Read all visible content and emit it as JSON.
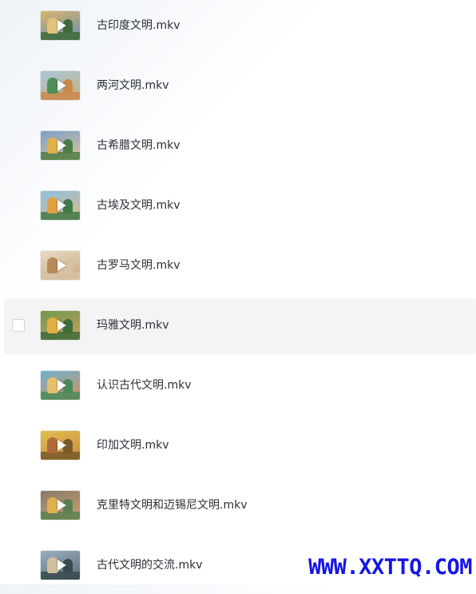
{
  "files": [
    {
      "name": "古印度文明.mkv",
      "thumb_colors": [
        "#d9b46a",
        "#6a8fb3",
        "#e3c27a",
        "#3f6b3a"
      ],
      "hovered": false
    },
    {
      "name": "两河文明.mkv",
      "thumb_colors": [
        "#a9c7d8",
        "#c9b083",
        "#4e8f5a",
        "#c98a4a"
      ],
      "hovered": false
    },
    {
      "name": "古希腊文明.mkv",
      "thumb_colors": [
        "#7aa0c8",
        "#d9c49a",
        "#e0b04a",
        "#4d7d46"
      ],
      "hovered": false
    },
    {
      "name": "古埃及文明.mkv",
      "thumb_colors": [
        "#8fc0e0",
        "#d8b98a",
        "#e0a040",
        "#3f7a48"
      ],
      "hovered": false
    },
    {
      "name": "古罗马文明.mkv",
      "thumb_colors": [
        "#e8dcc8",
        "#c9a77a",
        "#b98a5a",
        "#d7c2a4"
      ],
      "hovered": false
    },
    {
      "name": "玛雅文明.mkv",
      "thumb_colors": [
        "#6f9a4a",
        "#c9a060",
        "#e0b040",
        "#3f6b3a"
      ],
      "hovered": true
    },
    {
      "name": "认识古代文明.mkv",
      "thumb_colors": [
        "#6fb3d0",
        "#d0905a",
        "#e6c070",
        "#4a8a5a"
      ],
      "hovered": false
    },
    {
      "name": "印加文明.mkv",
      "thumb_colors": [
        "#e0c050",
        "#c98a40",
        "#b06a3a",
        "#7a5a2a"
      ],
      "hovered": false
    },
    {
      "name": "克里特文明和迈锡尼文明.mkv",
      "thumb_colors": [
        "#8a7a6a",
        "#c9a070",
        "#e0b050",
        "#5a8050"
      ],
      "hovered": false
    },
    {
      "name": "古代文明的交流.mkv",
      "thumb_colors": [
        "#9ab0c0",
        "#5a6a70",
        "#d0c0a0",
        "#3a4a50"
      ],
      "hovered": false
    }
  ],
  "watermark": "WWW.XXTTQ.COM",
  "colors": {
    "hover_row": "#f4f4f5",
    "text": "#2b2f36",
    "watermark": "#1515e6"
  }
}
